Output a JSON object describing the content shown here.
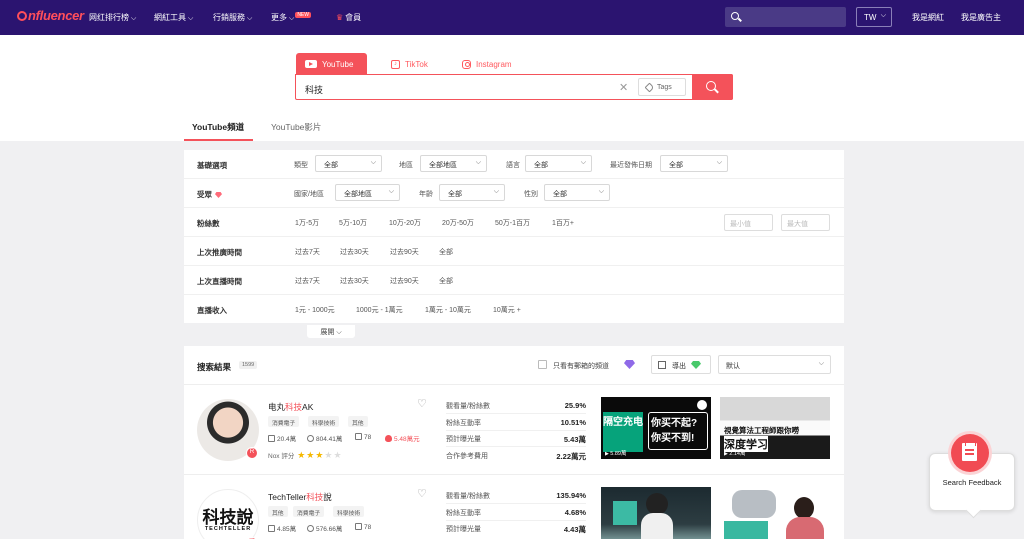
{
  "nav": {
    "logo": "nfluencer",
    "items": [
      {
        "label": "网红排行榜"
      },
      {
        "label": "網紅工具"
      },
      {
        "label": "行銷服務"
      },
      {
        "label": "更多"
      },
      {
        "label": "會員"
      }
    ],
    "new_badge": "NEW",
    "region": "TW",
    "right_links": [
      {
        "label": "我是網紅"
      },
      {
        "label": "我是廣告主"
      }
    ]
  },
  "platform_tabs": [
    {
      "label": "YouTube",
      "icon": "youtube-icon"
    },
    {
      "label": "TikTok",
      "icon": "tiktok-icon"
    },
    {
      "label": "Instagram",
      "icon": "instagram-icon"
    }
  ],
  "search": {
    "value": "科技",
    "tags_label": "Tags"
  },
  "sub_tabs": [
    {
      "label": "YouTube頻道",
      "active": true
    },
    {
      "label": "YouTube影片",
      "active": false
    }
  ],
  "filters": {
    "rows": [
      {
        "label": "基礎選項"
      },
      {
        "label": "受眾"
      },
      {
        "label": "粉絲數"
      },
      {
        "label": "上次推廣時間"
      },
      {
        "label": "上次直播時間"
      },
      {
        "label": "直播收入"
      }
    ],
    "basic": {
      "type_label": "類型",
      "type_value": "全部",
      "region_label": "地區",
      "region_value": "全部地區",
      "language_label": "語言",
      "language_value": "全部",
      "last_post_label": "最近發佈日期",
      "last_post_value": "全部"
    },
    "audience": {
      "country_label": "國家/地區",
      "country_value": "全部地區",
      "age_label": "年齡",
      "age_value": "全部",
      "gender_label": "性別",
      "gender_value": "全部"
    },
    "followers": [
      "1万-5万",
      "5万-10万",
      "10万-20万",
      "20万-50万",
      "50万-1百万",
      "1百万+"
    ],
    "followers_min_placeholder": "最小值",
    "followers_max_placeholder": "最大值",
    "promo_time": [
      "过去7天",
      "过去30天",
      "过去90天",
      "全部"
    ],
    "live_time": [
      "过去7天",
      "过去30天",
      "过去90天",
      "全部"
    ],
    "live_income": [
      "1元 - 1000元",
      "1000元 - 1萬元",
      "1萬元 - 10萬元",
      "10萬元 +"
    ],
    "expand_label": "展開"
  },
  "results": {
    "title": "搜索結果",
    "count": "1599",
    "checkbox_label": "只看有郵箱的頻道",
    "export_label": "導出",
    "sort_value": "默认",
    "metric_labels": [
      "觀看量/粉絲數",
      "粉絲互動率",
      "預計曝光量",
      "合作參考費用"
    ],
    "channels": [
      {
        "name_prefix": "电丸",
        "name_highlight": "科技",
        "name_suffix": "AK",
        "tags": [
          "消費電子",
          "科學技術",
          "其他"
        ],
        "followers": "20.4萬",
        "views": "804.41萬",
        "videos": "78",
        "income": "5.48萬元",
        "score_label": "Nox 評分",
        "rating": 3,
        "metrics": [
          "25.9%",
          "10.51%",
          "5.43萬",
          "2.22萬元"
        ],
        "video_views": [
          "5.89萬",
          "2.14萬"
        ],
        "thumb1_green": "隔空充电",
        "thumb1_text": "你买不起?你买不到!",
        "thumb2_line1": "視覺算法工程師跟你嘮",
        "thumb2_line2": "深度学习"
      },
      {
        "name_prefix": "TechTeller",
        "name_highlight": "科技",
        "name_suffix": "說",
        "tags": [
          "其他",
          "消費電子",
          "科學技術"
        ],
        "followers": "4.85萬",
        "views": "576.66萬",
        "videos": "78",
        "avatar_big": "科技說",
        "avatar_small": "TECHTELLER",
        "metrics": [
          "135.94%",
          "4.68%",
          "4.43萬"
        ]
      }
    ]
  },
  "feedback": {
    "label": "Search Feedback"
  },
  "colors": {
    "nav_bg": "#2b1470",
    "accent": "#f4525a",
    "star": "#f5b800"
  }
}
